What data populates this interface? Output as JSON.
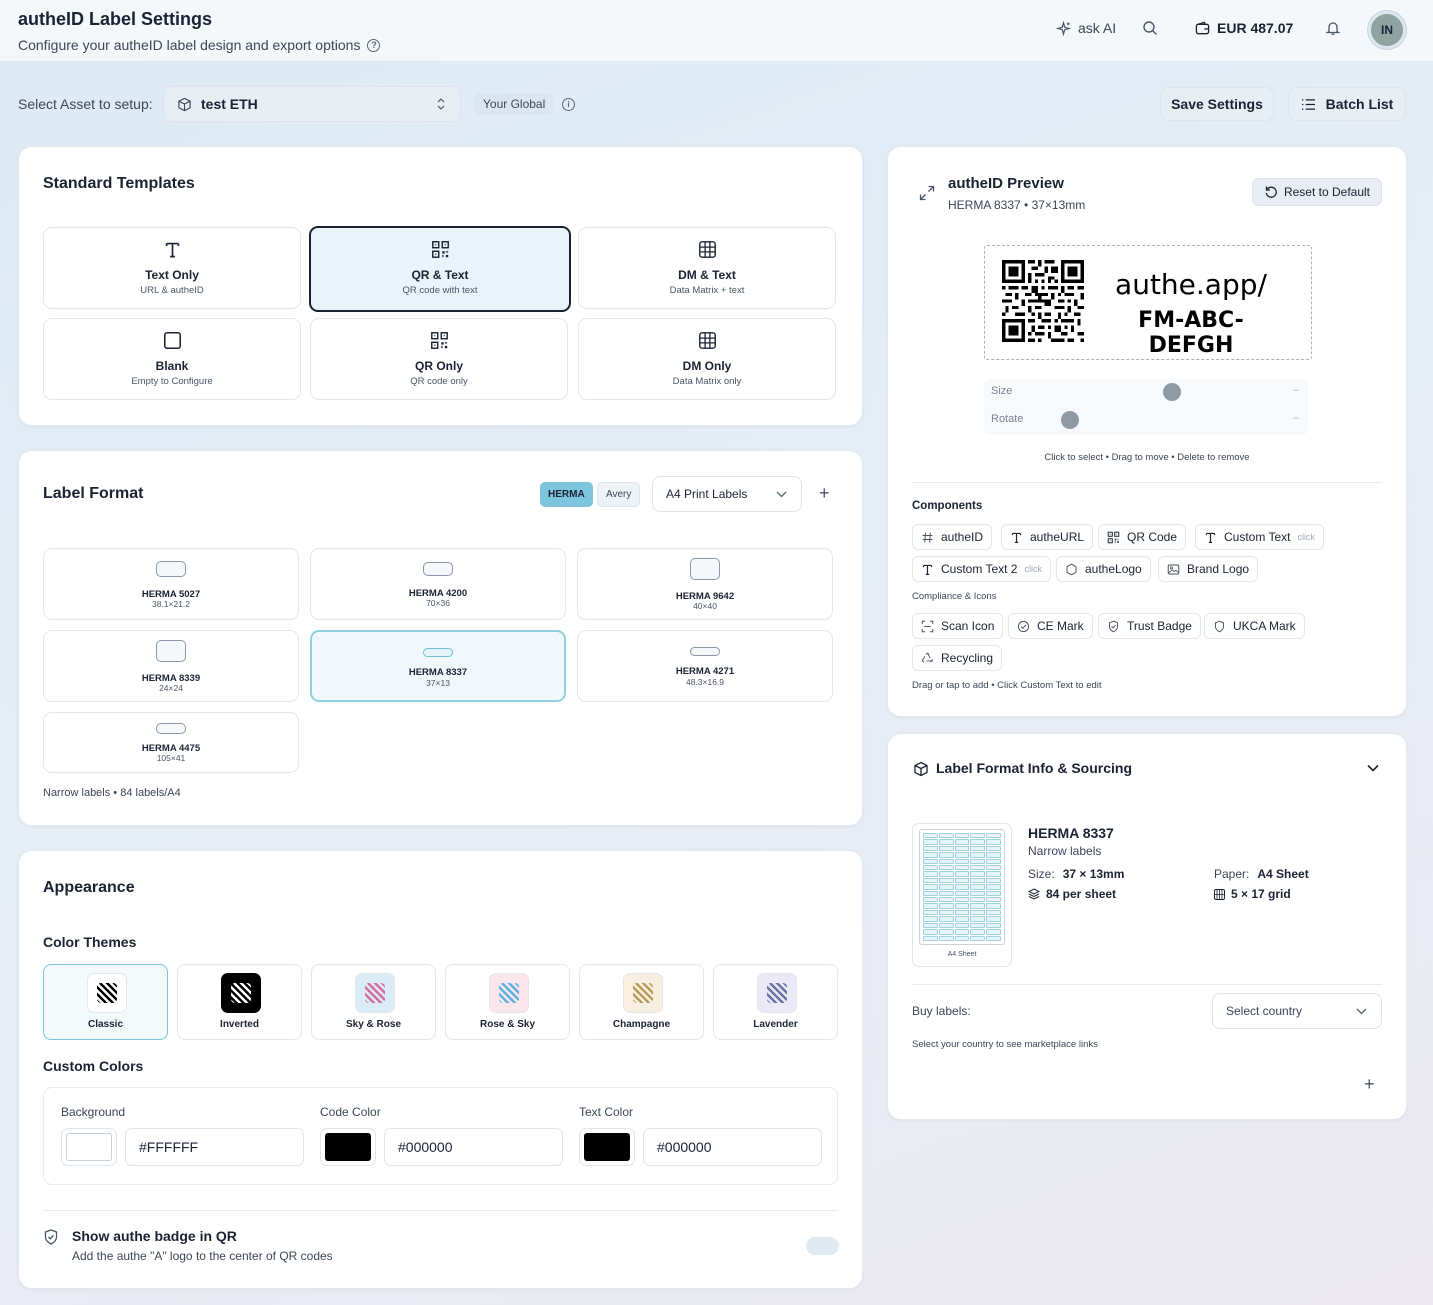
{
  "header": {
    "title": "autheID Label Settings",
    "subtitle": "Configure your autheID label design and export options",
    "ask_ai": "ask AI",
    "balance": "EUR 487.07",
    "avatar_initials": "IN"
  },
  "asset_bar": {
    "label": "Select Asset to setup:",
    "selected_asset": "test ETH",
    "scope_badge": "Your Global",
    "save_button": "Save Settings",
    "batch_button": "Batch List"
  },
  "templates": {
    "title": "Standard Templates",
    "items": [
      {
        "name": "Text Only",
        "desc": "URL & autheID",
        "icon": "text-icon",
        "selected": false
      },
      {
        "name": "QR & Text",
        "desc": "QR code with text",
        "icon": "qr-icon",
        "selected": true
      },
      {
        "name": "DM & Text",
        "desc": "Data Matrix + text",
        "icon": "grid-icon",
        "selected": false
      },
      {
        "name": "Blank",
        "desc": "Empty to Configure",
        "icon": "square-icon",
        "selected": false
      },
      {
        "name": "QR Only",
        "desc": "QR code only",
        "icon": "qr-icon",
        "selected": false
      },
      {
        "name": "DM Only",
        "desc": "Data Matrix only",
        "icon": "grid-icon",
        "selected": false
      }
    ]
  },
  "label_format": {
    "title": "Label Format",
    "brand_tabs": [
      "HERMA",
      "Avery"
    ],
    "active_brand": "HERMA",
    "sheet_select": "A4 Print Labels",
    "formats": [
      {
        "name": "HERMA 5027",
        "size": "38.1×21.2",
        "selected": false
      },
      {
        "name": "HERMA 4200",
        "size": "70×36",
        "selected": false
      },
      {
        "name": "HERMA 9642",
        "size": "40×40",
        "selected": false
      },
      {
        "name": "HERMA 8339",
        "size": "24×24",
        "selected": false
      },
      {
        "name": "HERMA 8337",
        "size": "37×13",
        "selected": true
      },
      {
        "name": "HERMA 4271",
        "size": "48.3×16.9",
        "selected": false
      },
      {
        "name": "HERMA 4475",
        "size": "105×41",
        "selected": false
      }
    ],
    "footer_note": "Narrow labels • 84 labels/A4"
  },
  "appearance": {
    "title": "Appearance",
    "themes_title": "Color Themes",
    "themes": [
      {
        "name": "Classic",
        "selected": true,
        "bg": "#ffffff",
        "stripe": "#000000"
      },
      {
        "name": "Inverted",
        "selected": false,
        "bg": "#000000",
        "stripe": "#ffffff"
      },
      {
        "name": "Sky & Rose",
        "selected": false,
        "bg": "#dcecf7",
        "stripe": "#d46fa0"
      },
      {
        "name": "Rose & Sky",
        "selected": false,
        "bg": "#fbe6ec",
        "stripe": "#5cb2e0"
      },
      {
        "name": "Champagne",
        "selected": false,
        "bg": "#f8efe0",
        "stripe": "#b89a5a"
      },
      {
        "name": "Lavender",
        "selected": false,
        "bg": "#ebe9f5",
        "stripe": "#6a72a8"
      }
    ],
    "custom_title": "Custom Colors",
    "background_label": "Background",
    "background_value": "#FFFFFF",
    "code_label": "Code Color",
    "code_value": "#000000",
    "text_label": "Text Color",
    "text_value": "#000000",
    "badge_title": "Show authe badge in QR",
    "badge_desc": "Add the authe \"A\" logo to the center of QR codes"
  },
  "preview": {
    "title": "autheID Preview",
    "subtitle": "HERMA 8337 • 37×13mm",
    "reset_button": "Reset to Default",
    "url_line1": "authe.app/",
    "url_line2": "FM-ABC-DEFGH",
    "size_label": "Size",
    "rotate_label": "Rotate",
    "size_value": "–",
    "rotate_value": "–",
    "hint": "Click to select • Drag to move • Delete to remove",
    "components_title": "Components",
    "components": [
      {
        "label": "autheID",
        "icon": "hash-icon"
      },
      {
        "label": "autheURL",
        "icon": "text-icon"
      },
      {
        "label": "QR Code",
        "icon": "qr-icon"
      },
      {
        "label": "Custom Text",
        "icon": "text-icon",
        "hint": "click"
      },
      {
        "label": "Custom Text 2",
        "icon": "text-icon",
        "hint": "click"
      },
      {
        "label": "autheLogo",
        "icon": "hexagon-icon"
      },
      {
        "label": "Brand Logo",
        "icon": "image-icon"
      }
    ],
    "compliance_title": "Compliance & Icons",
    "compliance": [
      {
        "label": "Scan Icon",
        "icon": "scan-icon"
      },
      {
        "label": "CE Mark",
        "icon": "check-circle-icon"
      },
      {
        "label": "Trust Badge",
        "icon": "shield-check-icon"
      },
      {
        "label": "UKCA Mark",
        "icon": "shield-icon"
      },
      {
        "label": "Recycling",
        "icon": "recycle-icon"
      }
    ],
    "footer_hint": "Drag or tap to add • Click Custom Text to edit"
  },
  "sourcing": {
    "title": "Label Format Info & Sourcing",
    "sheet_caption": "A4 Sheet",
    "format_name": "HERMA 8337",
    "format_type": "Narrow labels",
    "size_label": "Size:",
    "size_value": "37 × 13mm",
    "per_sheet": "84 per sheet",
    "paper_label": "Paper:",
    "paper_value": "A4 Sheet",
    "grid": "5 × 17 grid",
    "buy_label": "Buy labels:",
    "country_placeholder": "Select country",
    "country_hint": "Select your country to see marketplace links"
  },
  "colors": {
    "accent": "#7cc5dc",
    "selected_border": "#1a2233"
  }
}
